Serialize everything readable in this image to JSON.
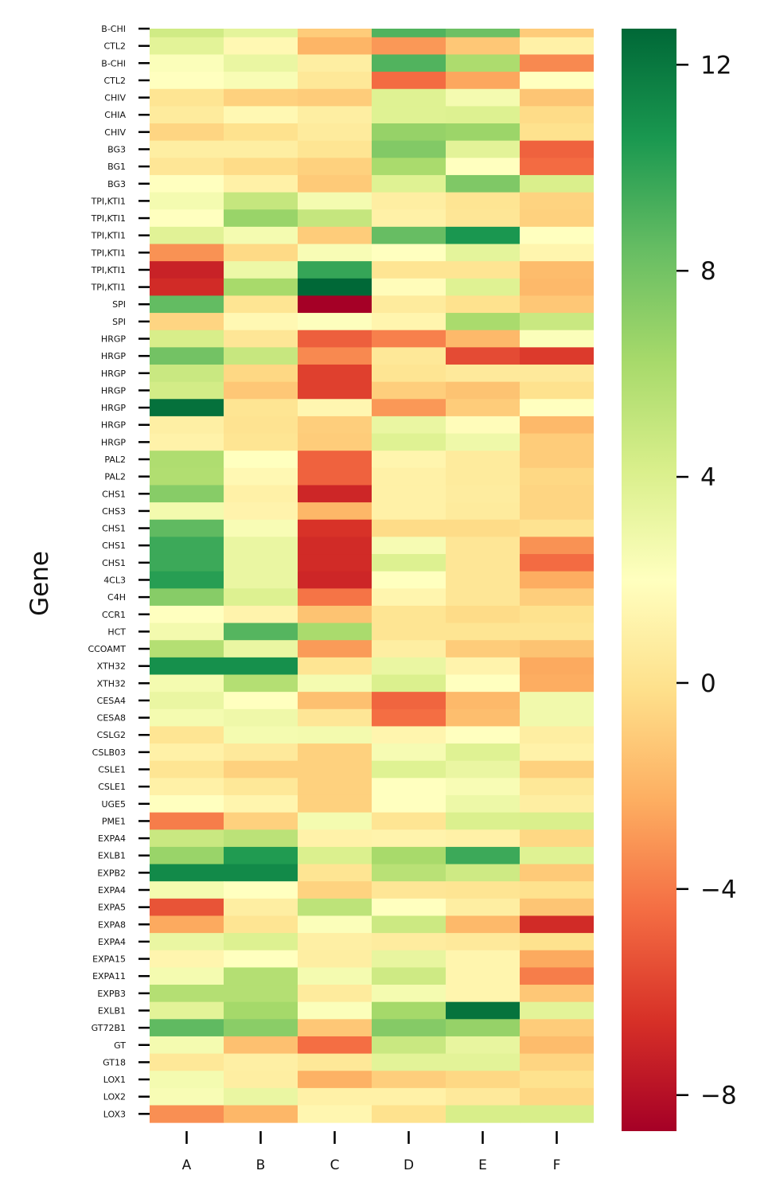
{
  "chart_data": {
    "type": "heatmap",
    "title": "",
    "xlabel": "",
    "ylabel": "Gene",
    "colormap": "RdYlGn",
    "colormap_stops": [
      "#a50026",
      "#d73027",
      "#f46d43",
      "#fdae61",
      "#fee08b",
      "#ffffbf",
      "#d9ef8b",
      "#a6d96a",
      "#66bd63",
      "#1a9850",
      "#006837"
    ],
    "vmin": -8.7,
    "vmax": 12.7,
    "colorbar_ticks": [
      12,
      8,
      4,
      0,
      -4,
      -8
    ],
    "colorbar_tick_labels": [
      "12",
      "8",
      "4",
      "0",
      "−4",
      "−8"
    ],
    "columns": [
      "A",
      "B",
      "C",
      "D",
      "E",
      "F"
    ],
    "rows": [
      "B-CHI",
      "CTL2",
      "B-CHI",
      "CTL2",
      "CHIV",
      "CHIA",
      "CHIV",
      "BG3",
      "BG1",
      "BG3",
      "TPI,KTI1",
      "TPI,KTI1",
      "TPI,KTI1",
      "TPI,KTI1",
      "TPI,KTI1",
      "TPI,KTI1",
      "SPI",
      "SPI",
      "HRGP",
      "HRGP",
      "HRGP",
      "HRGP",
      "HRGP",
      "HRGP",
      "HRGP",
      "PAL2",
      "PAL2",
      "CHS1",
      "CHS3",
      "CHS1",
      "CHS1",
      "CHS1",
      "4CL3",
      "C4H",
      "CCR1",
      "HCT",
      "CCOAMT",
      "XTH32",
      "XTH32",
      "CESA4",
      "CESA8",
      "CSLG2",
      "CSLB03",
      "CSLE1",
      "CSLE1",
      "UGE5",
      "PME1",
      "EXPA4",
      "EXLB1",
      "EXPB2",
      "EXPA4",
      "EXPA5",
      "EXPA8",
      "EXPA4",
      "EXPA15",
      "EXPA11",
      "EXPB3",
      "EXLB1",
      "GT72B1",
      "GT",
      "GT18",
      "LOX1",
      "LOX2",
      "LOX3"
    ],
    "values": [
      [
        4.5,
        3.5,
        -1.0,
        9.0,
        8.2,
        -1.0
      ],
      [
        3.6,
        1.5,
        -2.0,
        -3.0,
        -1.2,
        1.0
      ],
      [
        2.2,
        3.2,
        0.8,
        9.0,
        6.0,
        -3.5
      ],
      [
        2.0,
        2.4,
        0.4,
        -4.5,
        -2.5,
        2.0
      ],
      [
        0.2,
        -0.8,
        -1.0,
        3.8,
        2.6,
        -1.3
      ],
      [
        0.6,
        1.5,
        0.8,
        3.8,
        3.9,
        -0.3
      ],
      [
        -0.6,
        0.0,
        0.6,
        6.8,
        6.6,
        0.0
      ],
      [
        0.8,
        0.8,
        0.2,
        7.5,
        3.6,
        -4.8
      ],
      [
        0.3,
        -0.3,
        -0.8,
        6.1,
        2.0,
        -4.5
      ],
      [
        2.0,
        1.0,
        -1.1,
        3.8,
        7.6,
        4.1
      ],
      [
        2.6,
        5.0,
        2.6,
        0.8,
        0.2,
        -0.7
      ],
      [
        2.0,
        6.7,
        5.0,
        1.0,
        0.3,
        -0.8
      ],
      [
        3.7,
        2.6,
        -1.0,
        8.4,
        10.6,
        2.0
      ],
      [
        -3.2,
        -0.4,
        2.4,
        2.0,
        3.5,
        1.3
      ],
      [
        -7.2,
        3.0,
        9.8,
        0.2,
        0.2,
        -1.7
      ],
      [
        -6.8,
        6.2,
        12.7,
        1.8,
        3.8,
        -1.8
      ],
      [
        8.5,
        0.2,
        -8.7,
        0.6,
        0.0,
        -1.2
      ],
      [
        -0.6,
        1.5,
        2.1,
        1.3,
        6.1,
        4.8
      ],
      [
        4.2,
        0.3,
        -4.9,
        -3.8,
        -1.8,
        2.2
      ],
      [
        8.0,
        4.9,
        -3.5,
        0.4,
        -5.6,
        -6.2
      ],
      [
        4.8,
        -0.5,
        -6.0,
        0.2,
        0.5,
        0.5
      ],
      [
        4.4,
        -1.2,
        -6.0,
        -0.9,
        -1.4,
        0.0
      ],
      [
        12.3,
        0.2,
        1.4,
        -3.0,
        -1.0,
        2.0
      ],
      [
        0.9,
        0.1,
        -0.9,
        3.2,
        1.8,
        -1.8
      ],
      [
        1.1,
        0.2,
        -1.0,
        3.8,
        2.9,
        -1.0
      ],
      [
        5.9,
        2.0,
        -4.8,
        1.3,
        0.6,
        -1.0
      ],
      [
        5.8,
        1.5,
        -4.8,
        1.0,
        0.6,
        -0.5
      ],
      [
        7.3,
        1.0,
        -7.0,
        1.0,
        0.7,
        -0.6
      ],
      [
        2.7,
        1.2,
        -1.9,
        1.0,
        0.6,
        -0.6
      ],
      [
        8.6,
        2.4,
        -6.5,
        -0.3,
        -0.3,
        0.1
      ],
      [
        9.6,
        3.2,
        -6.8,
        2.5,
        0.3,
        -3.2
      ],
      [
        9.6,
        3.2,
        -6.8,
        3.9,
        0.3,
        -4.5
      ],
      [
        10.2,
        3.2,
        -7.0,
        2.0,
        0.3,
        -2.3
      ],
      [
        7.3,
        3.9,
        -4.2,
        1.3,
        0.3,
        -0.9
      ],
      [
        2.0,
        1.2,
        -1.4,
        0.2,
        -0.3,
        0.0
      ],
      [
        2.7,
        8.9,
        6.1,
        0.2,
        0.2,
        0.2
      ],
      [
        5.7,
        3.2,
        -2.9,
        0.8,
        -1.0,
        -1.4
      ],
      [
        10.9,
        10.9,
        0.2,
        3.2,
        1.2,
        -2.4
      ],
      [
        2.6,
        5.7,
        2.6,
        4.0,
        2.0,
        -2.3
      ],
      [
        3.2,
        2.0,
        -1.5,
        -4.7,
        -1.8,
        2.8
      ],
      [
        2.6,
        2.9,
        0.3,
        -4.4,
        -1.6,
        2.8
      ],
      [
        0.2,
        2.6,
        2.7,
        1.3,
        2.0,
        0.8
      ],
      [
        1.0,
        0.5,
        -0.8,
        2.5,
        3.8,
        1.1
      ],
      [
        0.2,
        -0.8,
        -0.8,
        3.8,
        3.2,
        -0.8
      ],
      [
        1.0,
        0.4,
        -0.8,
        2.0,
        2.4,
        0.4
      ],
      [
        2.0,
        1.3,
        -0.8,
        2.0,
        3.0,
        0.8
      ],
      [
        -3.9,
        -0.8,
        2.6,
        0.2,
        4.0,
        4.1
      ],
      [
        4.8,
        5.4,
        1.1,
        1.2,
        1.0,
        -0.5
      ],
      [
        6.7,
        10.4,
        4.0,
        6.2,
        9.6,
        3.8
      ],
      [
        11.2,
        11.2,
        0.2,
        5.5,
        4.6,
        -1.1
      ],
      [
        2.6,
        2.0,
        -0.7,
        0.3,
        0.2,
        0.0
      ],
      [
        -5.3,
        0.8,
        5.3,
        2.0,
        0.8,
        -1.3
      ],
      [
        -2.4,
        0.2,
        2.2,
        4.7,
        -1.8,
        -6.8
      ],
      [
        3.2,
        3.9,
        0.9,
        0.7,
        0.5,
        0.0
      ],
      [
        1.3,
        2.0,
        0.8,
        3.3,
        1.3,
        -2.4
      ],
      [
        2.6,
        5.7,
        2.6,
        4.6,
        1.3,
        -3.9
      ],
      [
        5.7,
        5.7,
        0.6,
        2.6,
        1.3,
        -1.2
      ],
      [
        3.6,
        6.3,
        2.2,
        6.3,
        12.2,
        3.6
      ],
      [
        8.6,
        7.2,
        -1.2,
        7.4,
        6.8,
        -1.0
      ],
      [
        2.6,
        -1.5,
        -4.4,
        4.8,
        3.3,
        -1.7
      ],
      [
        0.4,
        0.9,
        0.4,
        3.6,
        3.6,
        -0.6
      ],
      [
        2.6,
        0.8,
        -2.1,
        -0.9,
        -0.5,
        0.0
      ],
      [
        2.4,
        3.2,
        1.0,
        1.0,
        0.5,
        -0.5
      ],
      [
        -3.3,
        -1.9,
        1.4,
        0.0,
        4.2,
        4.2
      ]
    ]
  }
}
